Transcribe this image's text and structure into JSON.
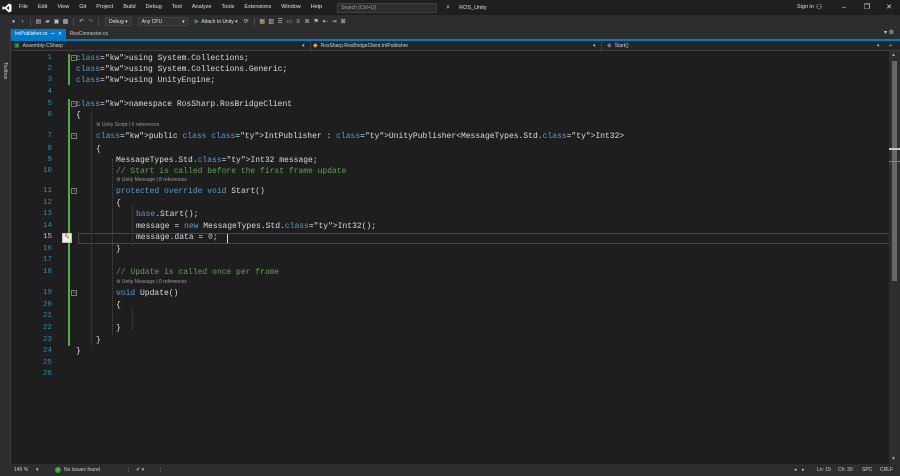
{
  "titlebar": {
    "menu": [
      "File",
      "Edit",
      "View",
      "Git",
      "Project",
      "Build",
      "Debug",
      "Test",
      "Analyze",
      "Tools",
      "Extensions",
      "Window",
      "Help"
    ],
    "search_placeholder": "Search (Ctrl+Q)",
    "solution_name": "ROS_Unity",
    "sign_in": "Sign in"
  },
  "toolbar": {
    "configuration": "Debug",
    "platform": "Any CPU",
    "attach_label": "Attach to Unity"
  },
  "toolbox": {
    "label": "Toolbox"
  },
  "tabs": [
    {
      "label": "IntPublisher.cs",
      "active": true
    },
    {
      "label": "RosConnector.cs",
      "active": false
    }
  ],
  "navbar": {
    "project": "Assembly-CSharp",
    "type": "RosSharp.RosBridgeClient.IntPublisher",
    "member": "Start()"
  },
  "editor": {
    "current_line": 15,
    "lines": [
      {
        "n": "1",
        "text": "using System.Collections;"
      },
      {
        "n": "2",
        "text": "using System.Collections.Generic;"
      },
      {
        "n": "3",
        "text": "using UnityEngine;"
      },
      {
        "n": "4",
        "text": ""
      },
      {
        "n": "5",
        "text": "namespace RosSharp.RosBridgeClient"
      },
      {
        "n": "6",
        "text": "{"
      },
      {
        "n": "7",
        "text": "public class IntPublisher : UnityPublisher<MessageTypes.Std.Int32>",
        "lens": "Unity Script | 0 references"
      },
      {
        "n": "8",
        "text": "{"
      },
      {
        "n": "9",
        "text": "MessageTypes.Std.Int32 message;"
      },
      {
        "n": "10",
        "text": "// Start is called before the first frame update"
      },
      {
        "n": "11",
        "text": "protected override void Start()",
        "lens": "Unity Message | 8 references"
      },
      {
        "n": "12",
        "text": "{"
      },
      {
        "n": "13",
        "text": "base.Start();"
      },
      {
        "n": "14",
        "text": "message = new MessageTypes.Std.Int32();"
      },
      {
        "n": "15",
        "text": "message.data = 0;"
      },
      {
        "n": "16",
        "text": "}"
      },
      {
        "n": "17",
        "text": ""
      },
      {
        "n": "18",
        "text": "// Update is called once per frame"
      },
      {
        "n": "19",
        "text": "void Update()",
        "lens": "Unity Message | 0 references"
      },
      {
        "n": "20",
        "text": "{"
      },
      {
        "n": "21",
        "text": ""
      },
      {
        "n": "22",
        "text": "}"
      },
      {
        "n": "23",
        "text": "}"
      },
      {
        "n": "24",
        "text": "}"
      },
      {
        "n": "25",
        "text": ""
      },
      {
        "n": "26",
        "text": ""
      }
    ]
  },
  "statusbar": {
    "zoom": "145 %",
    "issues": "No issues found",
    "line": "Ln: 15",
    "col": "Ch: 30",
    "whitespace": "SPC",
    "line_ending": "CRLF"
  },
  "colors": {
    "accent": "#007acc",
    "keyword": "#569cd6",
    "type": "#4ec9b0",
    "comment": "#57a64a",
    "number": "#b5cea8",
    "line_number": "#2b91af"
  }
}
